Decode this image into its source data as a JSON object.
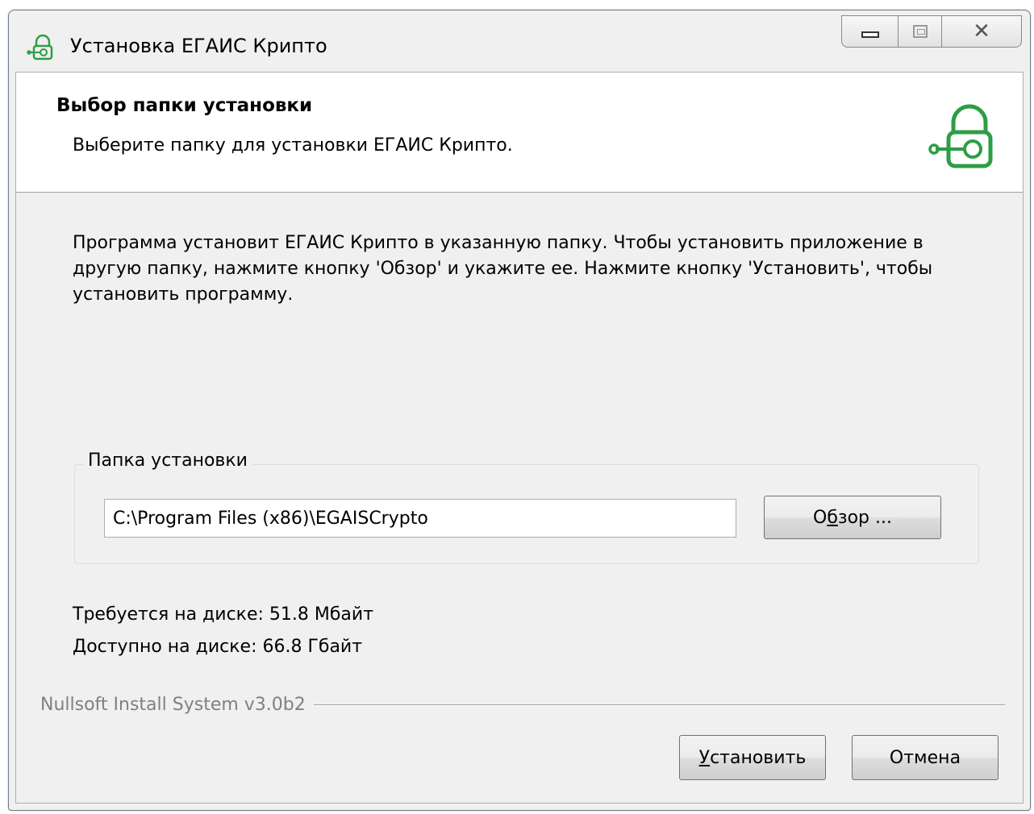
{
  "window": {
    "title": "Установка ЕГАИС Крипто",
    "controls": {
      "minimize": "—",
      "maximize": "□",
      "close": "✕"
    }
  },
  "header": {
    "title": "Выбор папки установки",
    "subtitle": "Выберите папку для установки ЕГАИС Крипто.",
    "icon": "lock-key-icon"
  },
  "main": {
    "description": "Программа установит ЕГАИС Крипто в указанную папку. Чтобы установить приложение в другую папку, нажмите кнопку 'Обзор' и укажите ее. Нажмите кнопку 'Установить', чтобы установить программу.",
    "folder_group": {
      "label": "Папка установки",
      "path_value": "C:\\Program Files (x86)\\EGAISCrypto",
      "browse": {
        "before": "О",
        "mnemonic": "б",
        "after": "зор ..."
      }
    },
    "disk_required": "Требуется на диске: 51.8 Мбайт",
    "disk_available": "Доступно на диске: 66.8 Гбайт"
  },
  "footer": {
    "branding": "Nullsoft Install System v3.0b2",
    "install": {
      "mnemonic": "У",
      "rest": "становить"
    },
    "cancel": "Отмена"
  },
  "colors": {
    "icon_green": "#2e9d45",
    "dialog_bg": "#f0f0f0",
    "header_bg": "#ffffff",
    "branding_gray": "#808080"
  }
}
